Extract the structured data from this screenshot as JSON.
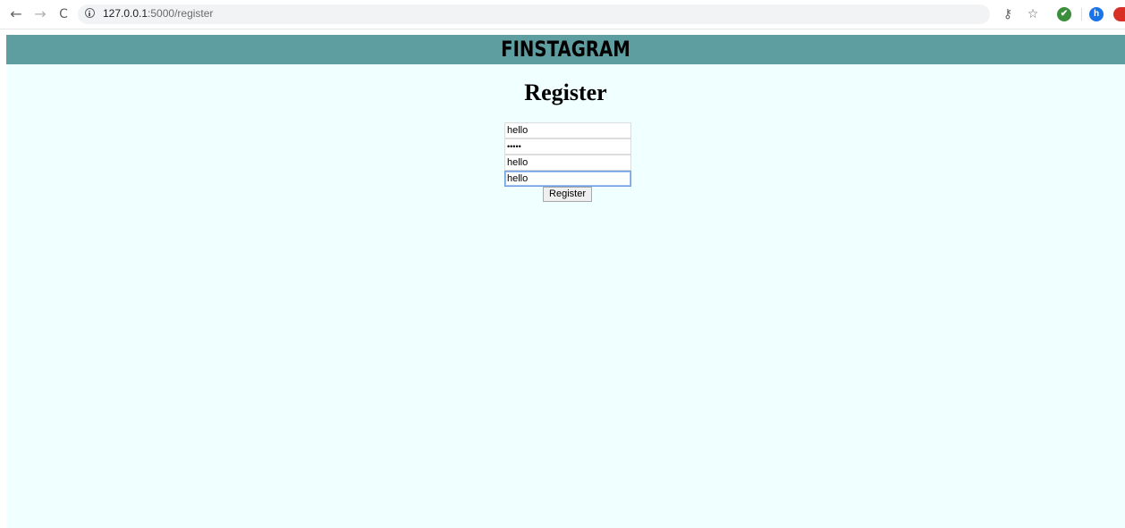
{
  "browser": {
    "back_glyph": "←",
    "forward_glyph": "→",
    "reload_glyph": "C",
    "url_host": "127.0.0.1",
    "url_path": ":5000/register",
    "icons": [
      "back-arrow-icon",
      "forward-arrow-icon",
      "reload-icon",
      "info-icon",
      "key-icon",
      "star-icon",
      "extension-check-icon",
      "profile-h-icon",
      "extension-red-icon"
    ],
    "key_glyph": "⚷",
    "star_glyph": "☆",
    "check_glyph": "✔",
    "profile_letter": "h",
    "colors": {
      "check": "#3c8d3c",
      "profile": "#1a73e8",
      "red_ext": "#d93025"
    }
  },
  "page": {
    "site_title": "FINSTAGRAM",
    "heading": "Register",
    "colors": {
      "background": "#f0ffff",
      "header_band": "#5f9ea0"
    }
  },
  "form": {
    "username_value": "hello",
    "password_dots": "•••••",
    "field3_value": "hello",
    "field4_value": "hello",
    "submit_label": "Register"
  }
}
